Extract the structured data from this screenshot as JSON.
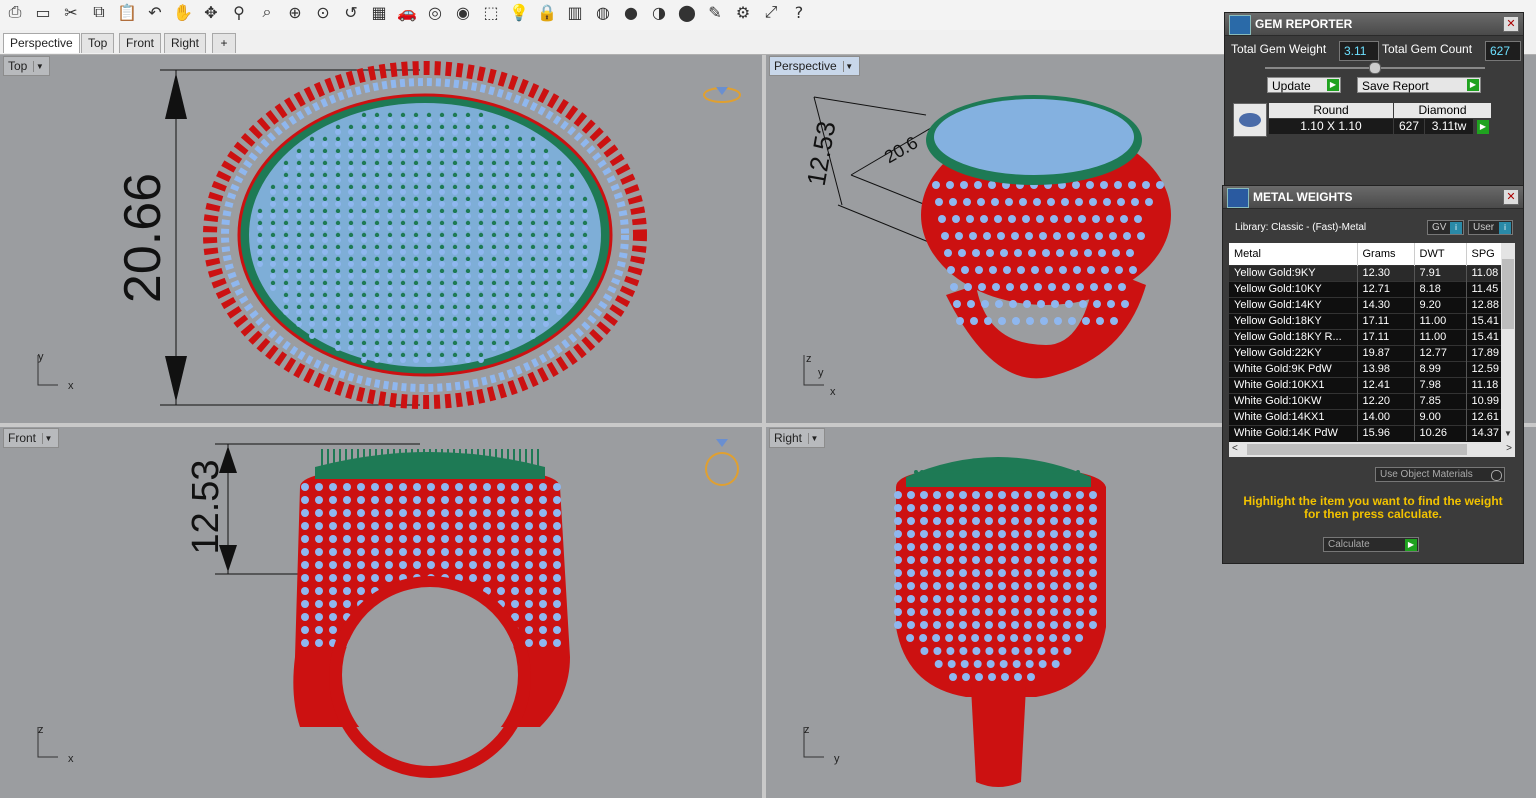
{
  "toolbar": {
    "icons": [
      "print-icon",
      "new-icon",
      "cut-icon",
      "copy-icon",
      "paste-icon",
      "undo-icon",
      "pan-icon",
      "rotate-icon",
      "zoom-icon",
      "zoom-window-icon",
      "zoom-extents-icon",
      "zoom-selected-icon",
      "zoom-undo-icon",
      "grid-icon",
      "car-icon",
      "hide-icon",
      "snap-icon",
      "select-icon",
      "light-icon",
      "lock-icon",
      "layer-icon",
      "color-icon",
      "shaded-icon",
      "rendered-icon",
      "material-icon",
      "pen-icon",
      "gear-icon",
      "dimension-icon",
      "help-icon"
    ]
  },
  "tabs": [
    "Perspective",
    "Top",
    "Front",
    "Right",
    "+"
  ],
  "viewports": {
    "top": {
      "label": "Top",
      "dimension": "20.66",
      "axis_a": "y",
      "axis_b": "x"
    },
    "perspective": {
      "label": "Perspective",
      "dimension_1": "12.53",
      "dimension_2": "20.6",
      "axis_a": "z",
      "axis_b": "y",
      "axis_c": "x"
    },
    "front": {
      "label": "Front",
      "dimension": "12.53",
      "axis_a": "z",
      "axis_b": "x"
    },
    "right": {
      "label": "Right",
      "axis_a": "z",
      "axis_b": "y"
    }
  },
  "gem_reporter": {
    "title": "GEM REPORTER",
    "total_weight_label": "Total Gem Weight",
    "total_weight_value": "3.11",
    "total_count_label": "Total Gem Count",
    "total_count_value": "627",
    "update_label": "Update",
    "save_label": "Save Report",
    "gem": {
      "shape": "Round",
      "type": "Diamond",
      "size": "1.10 X 1.10",
      "count": "627",
      "weight": "3.11tw"
    }
  },
  "metal_weights": {
    "title": "METAL WEIGHTS",
    "library": "Library: Classic - (Fast)-Metal",
    "gv_label": "GV",
    "user_label": "User",
    "columns": [
      "Metal",
      "Grams",
      "DWT",
      "SPG"
    ],
    "rows": [
      [
        "Yellow Gold:9KY",
        "12.30",
        "7.91",
        "11.08"
      ],
      [
        "Yellow Gold:10KY",
        "12.71",
        "8.18",
        "11.45"
      ],
      [
        "Yellow Gold:14KY",
        "14.30",
        "9.20",
        "12.88"
      ],
      [
        "Yellow Gold:18KY",
        "17.11",
        "11.00",
        "15.41"
      ],
      [
        "Yellow Gold:18KY R...",
        "17.11",
        "11.00",
        "15.41"
      ],
      [
        "Yellow Gold:22KY",
        "19.87",
        "12.77",
        "17.89"
      ],
      [
        "White Gold:9K PdW",
        "13.98",
        "8.99",
        "12.59"
      ],
      [
        "White Gold:10KX1",
        "12.41",
        "7.98",
        "11.18"
      ],
      [
        "White Gold:10KW",
        "12.20",
        "7.85",
        "10.99"
      ],
      [
        "White Gold:14KX1",
        "14.00",
        "9.00",
        "12.61"
      ],
      [
        "White Gold:14K PdW",
        "15.96",
        "10.26",
        "14.37"
      ]
    ],
    "use_object_materials": "Use Object Materials",
    "hint": "Highlight the item you want to find the weight for then press calculate.",
    "calculate_label": "Calculate"
  },
  "colors": {
    "metal": "#cc1111",
    "gem": "#8fb7ef",
    "prong": "#1e7a55",
    "viewport": "#9b9da0",
    "hint": "#f2c200"
  }
}
